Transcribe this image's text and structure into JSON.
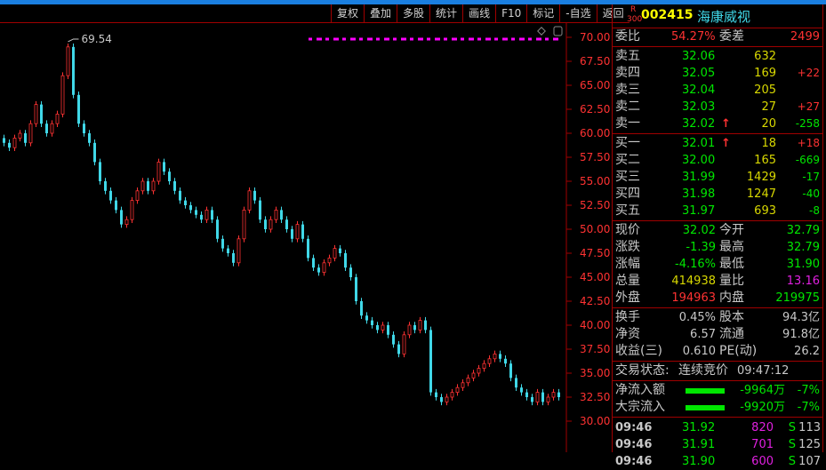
{
  "toolbar": [
    "复权",
    "叠加",
    "多股",
    "统计",
    "画线",
    "F10",
    "标记",
    "-自选",
    "返回"
  ],
  "stock": {
    "badge_top": "R",
    "badge_bottom": "300",
    "code": "002415",
    "name": "海康威视"
  },
  "weibi": {
    "label1": "委比",
    "value1": "54.27%",
    "label2": "委差",
    "value2": "2499"
  },
  "sell": [
    {
      "label": "卖五",
      "price": "32.06",
      "vol": "632",
      "chg": ""
    },
    {
      "label": "卖四",
      "price": "32.05",
      "vol": "169",
      "chg": "+22"
    },
    {
      "label": "卖三",
      "price": "32.04",
      "vol": "205",
      "chg": ""
    },
    {
      "label": "卖二",
      "price": "32.03",
      "vol": "27",
      "chg": "+27"
    },
    {
      "label": "卖一",
      "price": "32.02",
      "vol": "20",
      "chg": "-258",
      "arrow": "↑"
    }
  ],
  "buy": [
    {
      "label": "买一",
      "price": "32.01",
      "vol": "18",
      "chg": "+18",
      "arrow": "↑"
    },
    {
      "label": "买二",
      "price": "32.00",
      "vol": "165",
      "chg": "-669"
    },
    {
      "label": "买三",
      "price": "31.99",
      "vol": "1429",
      "chg": "-17"
    },
    {
      "label": "买四",
      "price": "31.98",
      "vol": "1247",
      "chg": "-40"
    },
    {
      "label": "买五",
      "price": "31.97",
      "vol": "693",
      "chg": "-8"
    }
  ],
  "quote": [
    {
      "l1": "现价",
      "v1": "32.02",
      "c1": "g",
      "l2": "今开",
      "v2": "32.79",
      "c2": "g"
    },
    {
      "l1": "涨跌",
      "v1": "-1.39",
      "c1": "g",
      "l2": "最高",
      "v2": "32.79",
      "c2": "g"
    },
    {
      "l1": "涨幅",
      "v1": "-4.16%",
      "c1": "g",
      "l2": "最低",
      "v2": "31.90",
      "c2": "g"
    },
    {
      "l1": "总量",
      "v1": "414938",
      "c1": "y",
      "l2": "量比",
      "v2": "13.16",
      "c2": "m"
    },
    {
      "l1": "外盘",
      "v1": "194963",
      "c1": "r",
      "l2": "内盘",
      "v2": "219975",
      "c2": "g"
    }
  ],
  "fund": [
    {
      "l1": "换手",
      "v1": "0.45%",
      "l2": "股本",
      "v2": "94.3亿"
    },
    {
      "l1": "净资",
      "v1": "6.57",
      "l2": "流通",
      "v2": "91.8亿"
    },
    {
      "l1": "收益(三)",
      "v1": "0.610",
      "l2": "PE(动)",
      "v2": "26.2"
    }
  ],
  "status": {
    "label": "交易状态:",
    "value": "连续竞价",
    "time": "09:47:12"
  },
  "flow": [
    {
      "label": "净流入额",
      "amount": "-9964万",
      "pct": "-7%",
      "fill": 0.55
    },
    {
      "label": "大宗流入",
      "amount": "-9920万",
      "pct": "-7%",
      "fill": 0.55
    }
  ],
  "ticks": [
    {
      "time": "09:46",
      "price": "31.92",
      "vol": "820",
      "side": "S",
      "count": "113"
    },
    {
      "time": "09:46",
      "price": "31.91",
      "vol": "701",
      "side": "S",
      "count": "125"
    },
    {
      "time": "09:46",
      "price": "31.90",
      "vol": "600",
      "side": "S",
      "count": "107"
    }
  ],
  "chart_data": {
    "type": "candlestick",
    "ylim": [
      30,
      70
    ],
    "yticks": [
      "70.00",
      "67.50",
      "65.00",
      "62.50",
      "60.00",
      "57.50",
      "55.00",
      "52.50",
      "50.00",
      "47.50",
      "45.00",
      "42.50",
      "40.00",
      "37.50",
      "35.00",
      "32.50",
      "30.00"
    ],
    "max_label": "69.54",
    "max_value": 69.54,
    "start_open": 59.5,
    "closes": [
      59,
      58.5,
      59.5,
      60,
      59,
      61,
      63,
      61,
      60,
      61,
      62,
      66,
      69,
      64,
      61,
      60,
      59,
      57,
      55,
      54,
      53,
      52,
      50.5,
      51,
      53,
      54,
      55,
      54,
      55,
      57,
      56,
      55,
      54,
      53,
      52.5,
      52,
      51.5,
      51,
      52,
      51,
      49,
      48,
      47.5,
      46.5,
      49,
      52,
      54,
      53,
      51,
      50,
      51,
      52,
      51,
      50,
      49,
      50.5,
      49,
      47,
      46,
      45.5,
      46.5,
      47,
      48,
      47.5,
      46,
      45,
      42.5,
      41,
      40.5,
      40,
      39.5,
      40,
      39,
      38,
      37,
      39,
      40,
      39.5,
      40.5,
      39.5,
      33,
      32.5,
      32,
      32.5,
      33,
      33.5,
      34,
      34.5,
      35,
      35.5,
      36,
      36.5,
      37,
      36.5,
      36,
      34.5,
      33.5,
      33,
      32.5,
      32,
      33,
      32,
      32.5,
      33,
      32.5
    ],
    "up_color": "#ff3232",
    "down_color": "#40d8e8"
  }
}
